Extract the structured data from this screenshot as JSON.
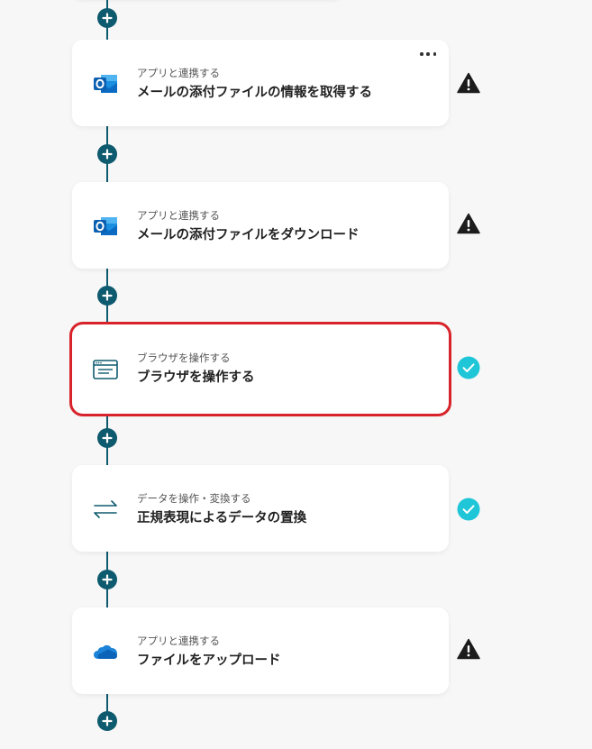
{
  "steps": [
    {
      "category": "アプリと連携する",
      "title": "メールの添付ファイルの情報を取得する",
      "icon": "outlook-icon",
      "status": "warning",
      "has_menu": true
    },
    {
      "category": "アプリと連携する",
      "title": "メールの添付ファイルをダウンロード",
      "icon": "outlook-icon",
      "status": "warning"
    },
    {
      "category": "ブラウザを操作する",
      "title": "ブラウザを操作する",
      "icon": "browser-window-icon",
      "status": "complete",
      "selected": true
    },
    {
      "category": "データを操作・変換する",
      "title": "正規表現によるデータの置換",
      "icon": "data-transform-arrows-icon",
      "status": "complete"
    },
    {
      "category": "アプリと連携する",
      "title": "ファイルをアップロード",
      "icon": "onedrive-cloud-icon",
      "status": "warning"
    }
  ],
  "colors": {
    "connector": "#0e5a6e",
    "selected_border": "#d8232a",
    "complete": "#1fc6d8",
    "warning": "#1c1c1c"
  }
}
